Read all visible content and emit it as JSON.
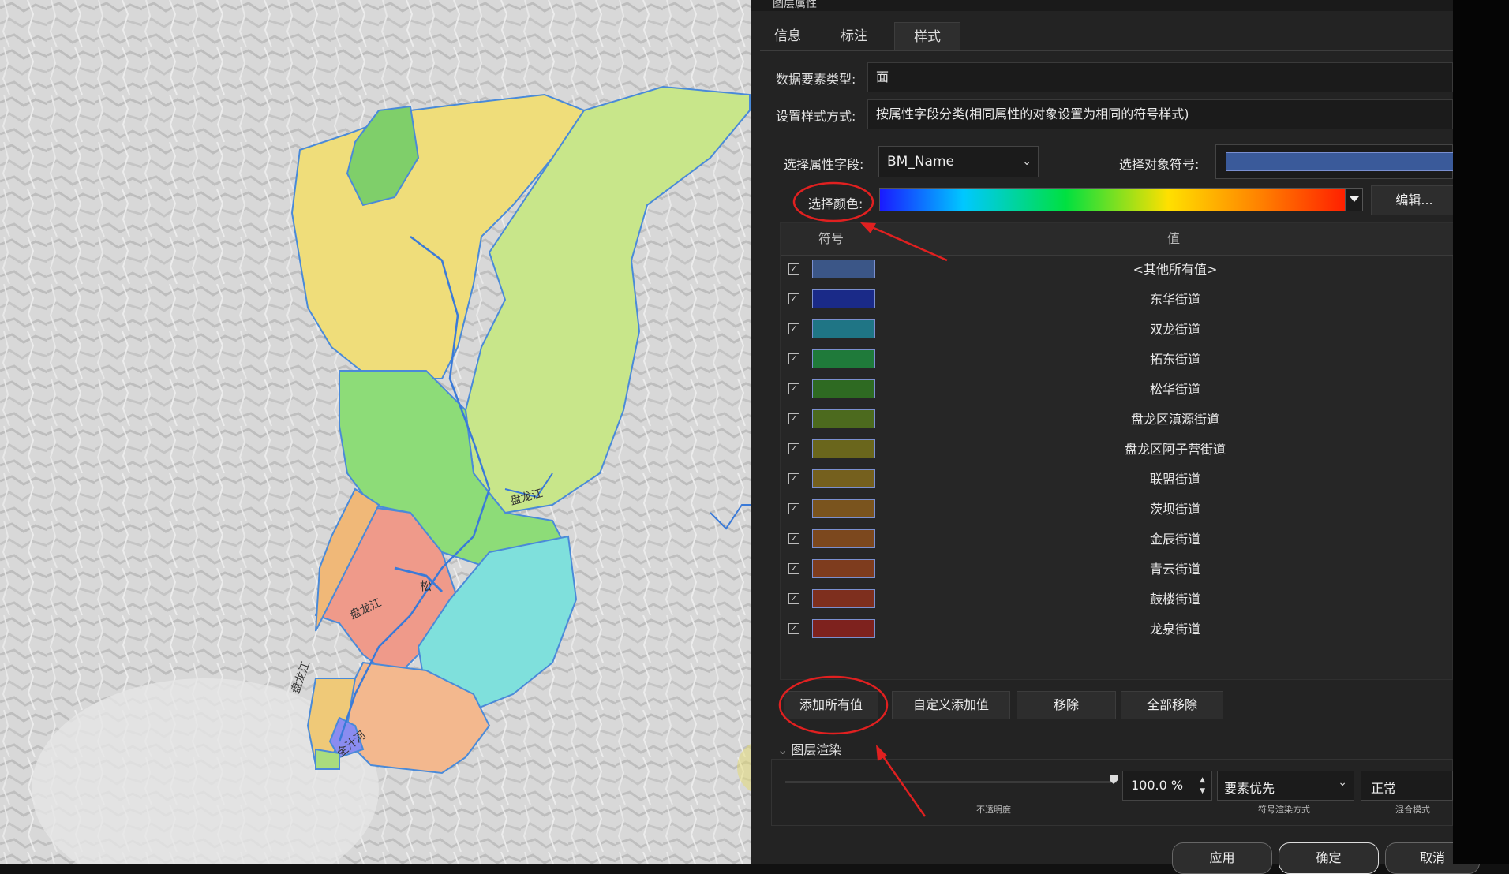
{
  "window": {
    "title": "图层属性"
  },
  "tabs": [
    {
      "label": "信息",
      "active": false
    },
    {
      "label": "标注",
      "active": false
    },
    {
      "label": "样式",
      "active": true
    }
  ],
  "form": {
    "feature_type_label": "数据要素类型:",
    "feature_type_value": "面",
    "style_method_label": "设置样式方式:",
    "style_method_value": "按属性字段分类(相同属性的对象设置为相同的符号样式)",
    "field_label": "选择属性字段:",
    "field_value": "BM_Name",
    "symbol_label": "选择对象符号:",
    "symbol_color": "#3a5a9a",
    "color_label": "选择颜色:",
    "edit_button": "编辑...",
    "color_ramp": [
      "#1a1aff",
      "#00c8ff",
      "#00e040",
      "#ffe000",
      "#ff8000",
      "#ff2000"
    ]
  },
  "table": {
    "header_symbol": "符号",
    "header_value": "值",
    "rows": [
      {
        "checked": true,
        "color": "#3b5687",
        "value": "<其他所有值>"
      },
      {
        "checked": true,
        "color": "#1a2a88",
        "value": "东华街道"
      },
      {
        "checked": true,
        "color": "#1f7585",
        "value": "双龙街道"
      },
      {
        "checked": true,
        "color": "#1f7a3a",
        "value": "拓东街道"
      },
      {
        "checked": true,
        "color": "#2e6a22",
        "value": "松华街道"
      },
      {
        "checked": true,
        "color": "#4c6a1e",
        "value": "盘龙区滇源街道"
      },
      {
        "checked": true,
        "color": "#6a661c",
        "value": "盘龙区阿子营街道"
      },
      {
        "checked": true,
        "color": "#75601e",
        "value": "联盟街道"
      },
      {
        "checked": true,
        "color": "#7a541e",
        "value": "茨坝街道"
      },
      {
        "checked": true,
        "color": "#7c481e",
        "value": "金辰街道"
      },
      {
        "checked": true,
        "color": "#7e3c1e",
        "value": "青云街道"
      },
      {
        "checked": true,
        "color": "#7e2f1e",
        "value": "鼓楼街道"
      },
      {
        "checked": true,
        "color": "#7e221e",
        "value": "龙泉街道"
      }
    ]
  },
  "buttons": {
    "add_all": "添加所有值",
    "custom_add": "自定义添加值",
    "remove": "移除",
    "remove_all": "全部移除"
  },
  "render": {
    "section_label": "图层渲染",
    "opacity_value": "100.0 %",
    "opacity_caption": "不透明度",
    "render_mode_value": "要素优先",
    "render_mode_caption": "符号渲染方式",
    "blend_value": "正常",
    "blend_caption": "混合模式"
  },
  "footer": {
    "apply": "应用",
    "ok": "确定",
    "cancel": "取消"
  },
  "map": {
    "labels": [
      "盘龙江",
      "盘龙江",
      "盘龙江",
      "松",
      "金汁河"
    ]
  },
  "annotation_color": "#e02020"
}
